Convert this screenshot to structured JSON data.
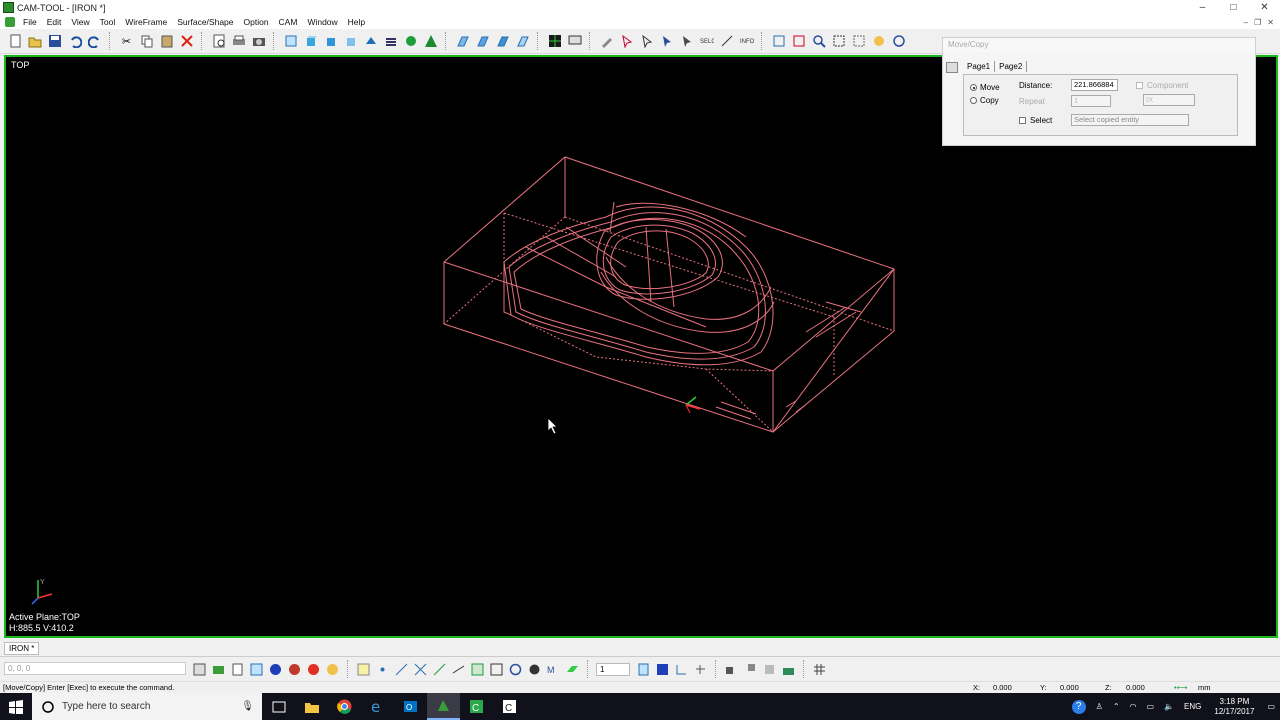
{
  "window": {
    "title": "CAM-TOOL - [IRON *]",
    "minimize": "–",
    "maximize": "□",
    "close": "✕"
  },
  "menu": [
    "File",
    "Edit",
    "View",
    "Tool",
    "WireFrame",
    "Surface/Shape",
    "Option",
    "CAM",
    "Window",
    "Help"
  ],
  "viewport": {
    "view_name": "TOP",
    "active_plane": "Active Plane:TOP",
    "hv_readout": "H:885.5 V:410.2",
    "triad_label": "Y"
  },
  "dialog": {
    "title": "Move/Copy",
    "tabs": [
      "Page1",
      "Page2"
    ],
    "move_label": "Move",
    "copy_label": "Copy",
    "mode_selected": "Move",
    "distance_label": "Distance:",
    "distance_value": "221.866884",
    "repeat_label": "Repeat",
    "repeat_value": "1",
    "component_label": "Component",
    "component_value": "IX",
    "select_label": "Select",
    "select_placeholder": "Select copied entity"
  },
  "document_tab": "IRON *",
  "coord_input": "0, 0, 0",
  "layer_value": "1",
  "status": {
    "message": "[Move/Copy] Enter [Exec] to execute the command.",
    "x_label": "X:",
    "x_value": "0.000",
    "y_label": "Y:",
    "y_value": "0.000",
    "z_label": "Z:",
    "z_value": "0.000",
    "units": "mm"
  },
  "taskbar": {
    "search_placeholder": "Type here to search",
    "time": "3:18 PM",
    "date": "12/17/2017",
    "language": "ENG"
  },
  "colors": {
    "viewport_bg": "#000000",
    "viewport_border": "#1bb61b",
    "model_wire": "#e8727f",
    "taskbar_bg": "#10111a"
  }
}
